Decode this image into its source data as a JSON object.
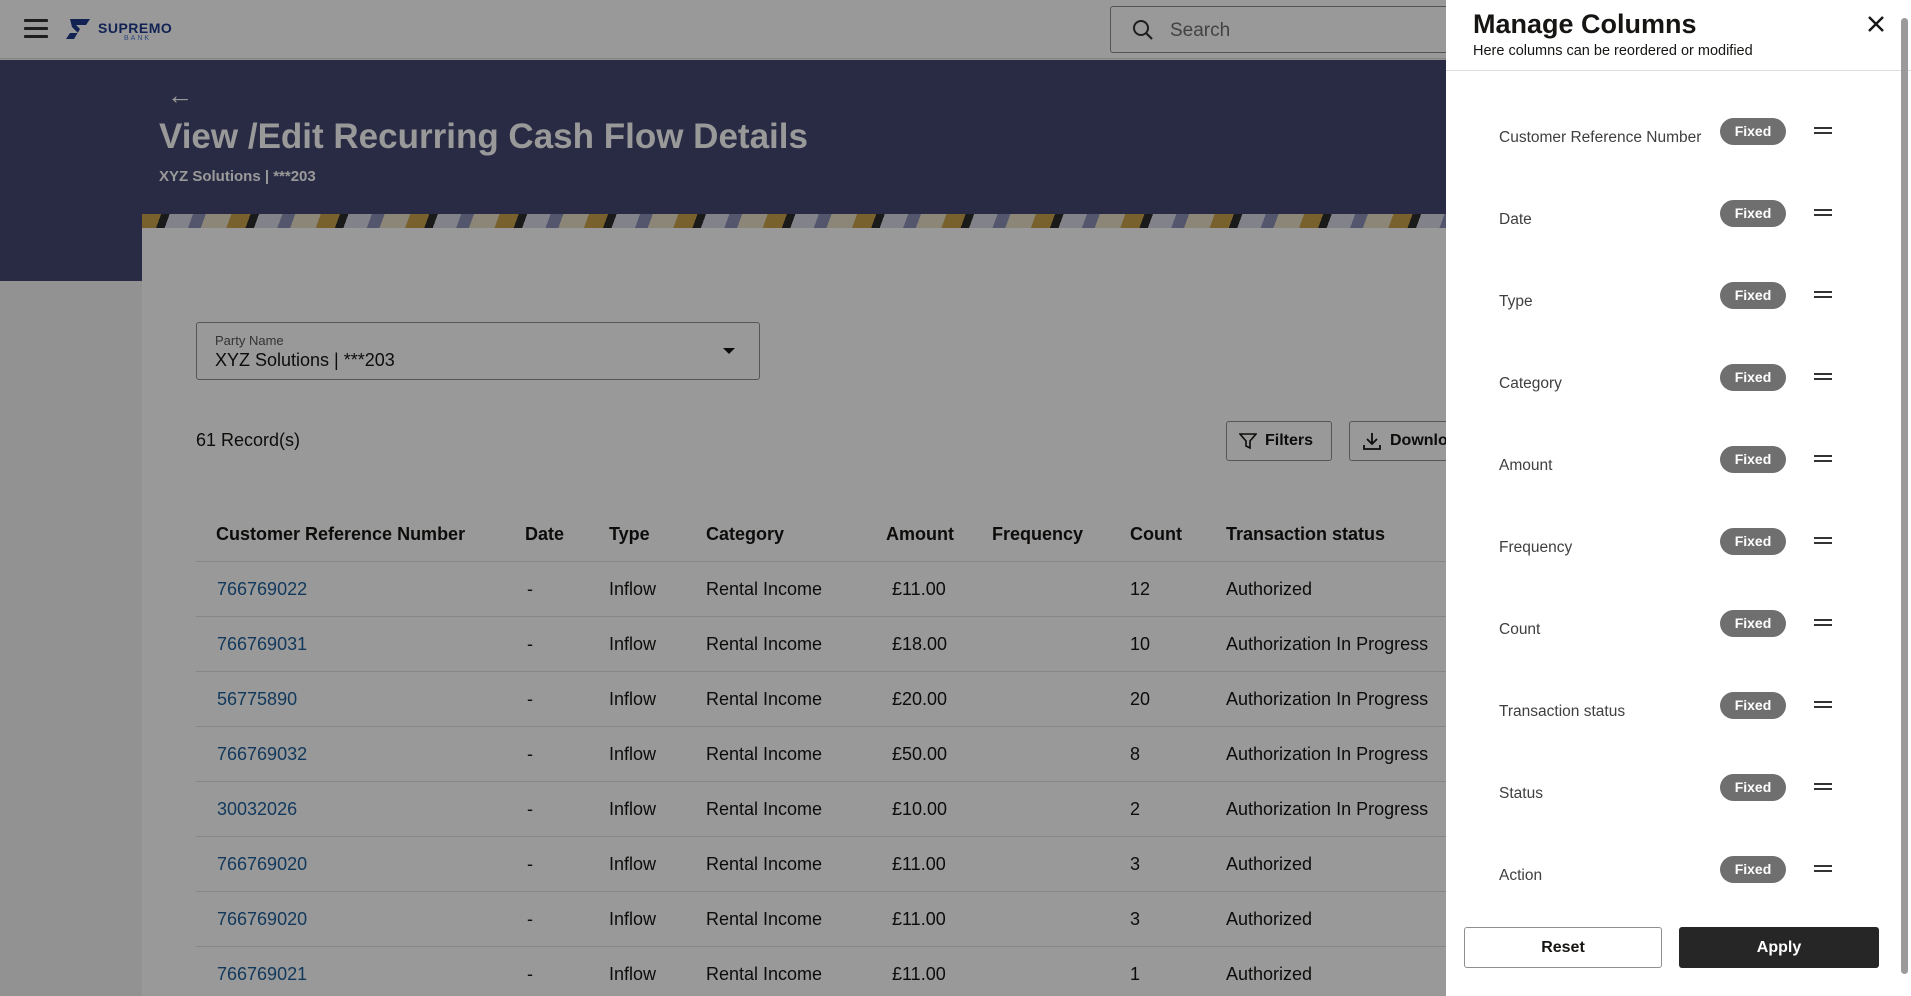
{
  "header": {
    "logo_text": "SUPREMO",
    "logo_subtext": "BANK",
    "search_placeholder": "Search",
    "menu_icon": "hamburger-menu-icon"
  },
  "page": {
    "title": "View /Edit Recurring Cash Flow Details",
    "subtitle": "XYZ Solutions | ***203",
    "back_icon": "back-arrow-icon"
  },
  "filters": {
    "party_label": "Party Name",
    "party_value": "XYZ Solutions | ***203",
    "record_count": "61 Record(s)",
    "filters_button": "Filters",
    "download_button": "Downlo"
  },
  "table": {
    "headers": [
      "Customer Reference Number",
      "Date",
      "Type",
      "Category",
      "Amount",
      "Frequency",
      "Count",
      "Transaction status"
    ],
    "rows": [
      {
        "ref": "766769022",
        "date": "-",
        "type": "Inflow",
        "category": "Rental Income",
        "amount": "£11.00",
        "frequency": "",
        "count": "12",
        "status": "Authorized"
      },
      {
        "ref": "766769031",
        "date": "-",
        "type": "Inflow",
        "category": "Rental Income",
        "amount": "£18.00",
        "frequency": "",
        "count": "10",
        "status": "Authorization In Progress"
      },
      {
        "ref": "56775890",
        "date": "-",
        "type": "Inflow",
        "category": "Rental Income",
        "amount": "£20.00",
        "frequency": "",
        "count": "20",
        "status": "Authorization In Progress"
      },
      {
        "ref": "766769032",
        "date": "-",
        "type": "Inflow",
        "category": "Rental Income",
        "amount": "£50.00",
        "frequency": "",
        "count": "8",
        "status": "Authorization In Progress"
      },
      {
        "ref": "30032026",
        "date": "-",
        "type": "Inflow",
        "category": "Rental Income",
        "amount": "£10.00",
        "frequency": "",
        "count": "2",
        "status": "Authorization In Progress"
      },
      {
        "ref": "766769020",
        "date": "-",
        "type": "Inflow",
        "category": "Rental Income",
        "amount": "£11.00",
        "frequency": "",
        "count": "3",
        "status": "Authorized"
      },
      {
        "ref": "766769020",
        "date": "-",
        "type": "Inflow",
        "category": "Rental Income",
        "amount": "£11.00",
        "frequency": "",
        "count": "3",
        "status": "Authorized"
      },
      {
        "ref": "766769021",
        "date": "-",
        "type": "Inflow",
        "category": "Rental Income",
        "amount": "£11.00",
        "frequency": "",
        "count": "1",
        "status": "Authorized"
      }
    ]
  },
  "panel": {
    "title": "Manage Columns",
    "subtitle": "Here columns can be reordered or modified",
    "columns": [
      {
        "label": "Customer Reference Number",
        "badge": "Fixed"
      },
      {
        "label": "Date",
        "badge": "Fixed"
      },
      {
        "label": "Type",
        "badge": "Fixed"
      },
      {
        "label": "Category",
        "badge": "Fixed"
      },
      {
        "label": "Amount",
        "badge": "Fixed"
      },
      {
        "label": "Frequency",
        "badge": "Fixed"
      },
      {
        "label": "Count",
        "badge": "Fixed"
      },
      {
        "label": "Transaction status",
        "badge": "Fixed"
      },
      {
        "label": "Status",
        "badge": "Fixed"
      },
      {
        "label": "Action",
        "badge": "Fixed"
      }
    ],
    "reset_label": "Reset",
    "apply_label": "Apply"
  },
  "colors": {
    "hero_bg": "#434870",
    "link": "#1f5f9a",
    "badge_bg": "#6f6f6f",
    "apply_bg": "#262626",
    "overlay": "rgba(0,0,0,0.40)"
  }
}
